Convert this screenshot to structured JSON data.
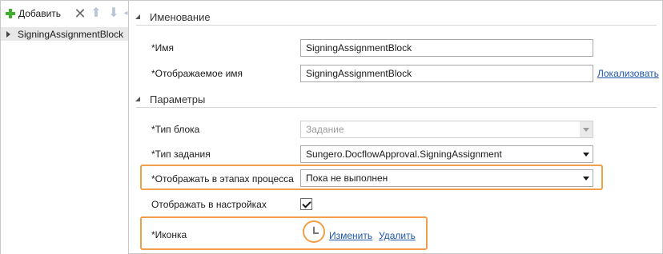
{
  "toolbar": {
    "add_label": "Добавить",
    "icons": [
      "plus-icon",
      "close-icon",
      "arrow-up-icon",
      "arrow-down-icon",
      "more-icon"
    ]
  },
  "tree": {
    "items": [
      {
        "label": "SigningAssignmentBlock",
        "expanded": false,
        "selected": true
      }
    ]
  },
  "sections": {
    "naming": {
      "title": "Именование",
      "name_label": "*Имя",
      "name_value": "SigningAssignmentBlock",
      "display_label": "*Отображаемое имя",
      "display_value": "SigningAssignmentBlock",
      "localize_link": "Локализовать"
    },
    "params": {
      "title": "Параметры",
      "block_type_label": "*Тип блока",
      "block_type_value": "Задание",
      "task_type_label": "*Тип задания",
      "task_type_value": "Sungero.DocflowApproval.SigningAssignment",
      "show_in_stages_label": "*Отображать в этапах процесса",
      "show_in_stages_value": "Пока не выполнен",
      "show_in_settings_label": "Отображать в настройках",
      "show_in_settings_checked": true,
      "icon_label": "*Иконка",
      "change_link": "Изменить",
      "delete_link": "Удалить"
    }
  },
  "colors": {
    "highlight": "#f0a04b",
    "link": "#1f58a8",
    "add_icon": "#3fae2a"
  }
}
